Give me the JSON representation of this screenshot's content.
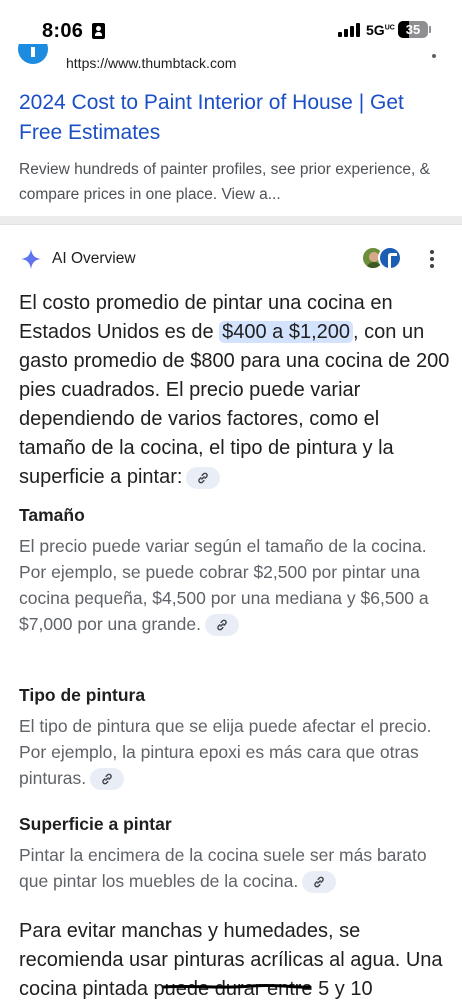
{
  "status_bar": {
    "time": "8:06",
    "network": "5G",
    "network_sup": "UC",
    "battery": "35",
    "battery_level": 0.35
  },
  "previous_result": {
    "url": "https://www.thumbtack.com",
    "title": "2024 Cost to Paint Interior of House | Get Free Estimates",
    "snippet": "Review hundreds of painter profiles, see prior experience, & compare prices in one place. View a..."
  },
  "ai_overview": {
    "title": "AI Overview",
    "summary_before": "El costo promedio de pintar una cocina en Estados Unidos es de ",
    "summary_highlight": "$400 a $1,200",
    "summary_after": ", con un gasto promedio de $800 para una cocina de 200 pies cuadrados. El precio puede variar dependiendo de varios factores, como el tamaño de la cocina, el tipo de pintura y la superficie a pintar:",
    "sections": [
      {
        "heading": "Tamaño",
        "body": "El precio puede variar según el tamaño de la cocina. Por ejemplo, se puede cobrar $2,500 por pintar una cocina pequeña, $4,500 por una mediana y $6,500 a $7,000 por una grande."
      },
      {
        "heading": "Tipo de pintura",
        "body": "El tipo de pintura que se elija puede afectar el precio. Por ejemplo, la pintura epoxi es más cara que otras pinturas."
      },
      {
        "heading": "Superficie a pintar",
        "body": "Pintar la encimera de la cocina suele ser más barato que pintar los muebles de la cocina."
      }
    ],
    "closing": "Para evitar manchas y humedades, se recomienda usar pinturas acrílicas al agua. Una cocina pintada puede durar entre 5 y 10"
  },
  "colors": {
    "link": "#1a4fc5",
    "highlight": "#d3e3fd",
    "chip": "#e9eef6",
    "muted_text": "#5f6368"
  }
}
